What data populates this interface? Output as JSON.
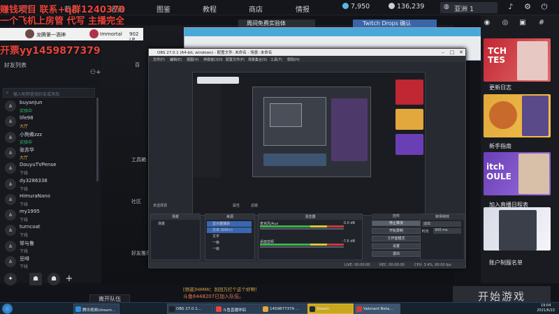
{
  "overlay": {
    "line1": "赚钱项目 联系+q群1240370",
    "line2": "一个飞机上房管 代写 主播完全",
    "line3": "开票yy1459877379"
  },
  "topnav": {
    "items": [
      "大厅",
      "截品",
      "收藏",
      "图鉴",
      "教程",
      "商店",
      "情报"
    ],
    "currency1": "7,950",
    "currency2": "136,239",
    "region": "亚洲 1"
  },
  "notification": {
    "user1": "龙腾第一酒神",
    "user2": "Immortal",
    "lp": "902 LP"
  },
  "sidebar": {
    "friends_title": "好友列表",
    "search_placeholder": "输入昵称查找好友或添加",
    "friends": [
      {
        "name": "buyanjun",
        "status": "实验中",
        "kind": "lobby"
      },
      {
        "name": "life98",
        "status": "大厅",
        "kind": "on"
      },
      {
        "name": "小狗煮zzz",
        "status": "实验中",
        "kind": "lobby"
      },
      {
        "name": "张苏华",
        "status": "大厅",
        "kind": "on"
      },
      {
        "name": "DouyuTVPense",
        "status": "下线",
        "kind": "off"
      },
      {
        "name": "dy3286338",
        "status": "下线",
        "kind": "off"
      },
      {
        "name": "HimuraNano",
        "status": "下线",
        "kind": "off"
      },
      {
        "name": "my1995",
        "status": "下线",
        "kind": "off"
      },
      {
        "name": "turncoat",
        "status": "下线",
        "kind": "off"
      },
      {
        "name": "琴与鲁",
        "status": "下线",
        "kind": "off"
      },
      {
        "name": "豆啡",
        "status": "下线",
        "kind": "off"
      }
    ]
  },
  "game": {
    "tag1": "百",
    "tag2": "工具箱",
    "tag3": "好友推荐",
    "tag4": "社区"
  },
  "promo": {
    "tab1": "周间免费实验体",
    "tab2": "Twitch Drops 确认"
  },
  "right_cards": [
    {
      "label": "更新日志",
      "art": "TCH\nTES"
    },
    {
      "label": "新手指南",
      "art": ""
    },
    {
      "label": "加入直播日程表",
      "art": "itch\nOULE"
    },
    {
      "label": "账户制服名单",
      "art": ""
    }
  ],
  "chat": {
    "line1": "[频道]HIMMI：别回万打个这个好啊！",
    "line2": "斗鱼6448207已加入队伍。"
  },
  "buttons": {
    "leave": "离开队伍",
    "start": "开始游戏"
  },
  "obs": {
    "title": "OBS 27.0.1 (64-bit, windows) - 配置文件: 未命名 - 场景: 未命名",
    "menu": [
      "文件(F)",
      "编辑(E)",
      "视图(V)",
      "停靠窗口(D)",
      "配置文件(P)",
      "场景集合(S)",
      "工具(T)",
      "帮助(H)"
    ],
    "dock_title": "未选择源",
    "prop_label": "属性",
    "filter_label": "滤镜",
    "panels": {
      "scenes": "场景",
      "sources": "来源",
      "mixer": "混音器",
      "transitions": "转场特效",
      "controls": "控件"
    },
    "scene_item": "场景",
    "sources": [
      "显示器捕获",
      "文本 (GDI+)",
      "文字",
      "一级",
      "一级"
    ],
    "mixer": [
      {
        "name": "麦克风/Aux",
        "db": "0.0 dB"
      },
      {
        "name": "桌面音频",
        "db": "-7.6 dB"
      }
    ],
    "transition": "淡出",
    "duration_label": "时长",
    "duration": "300 ms",
    "controls": [
      "停止推流",
      "开始录制",
      "工作室模式",
      "设置",
      "退出"
    ],
    "status": {
      "live": "LIVE: 00:00:00",
      "rec": "REC: 00:00:00",
      "cpu": "CPU: 3.4%, 60.00 fps"
    }
  },
  "taskbar": {
    "tasks": [
      "腾讯视频(dream...",
      "OBS 27.0.1...",
      "斗鱼直播伴侣",
      "1459877379 ...",
      "Steam",
      "Valorant Beta..."
    ],
    "clock_time": "19:04",
    "clock_date": "2021/6/22"
  },
  "colors": {
    "overlay_red": "#e8443a",
    "accent_blue": "#4aa8d8",
    "online_green": "#39c26c",
    "away_orange": "#e2a73d"
  }
}
